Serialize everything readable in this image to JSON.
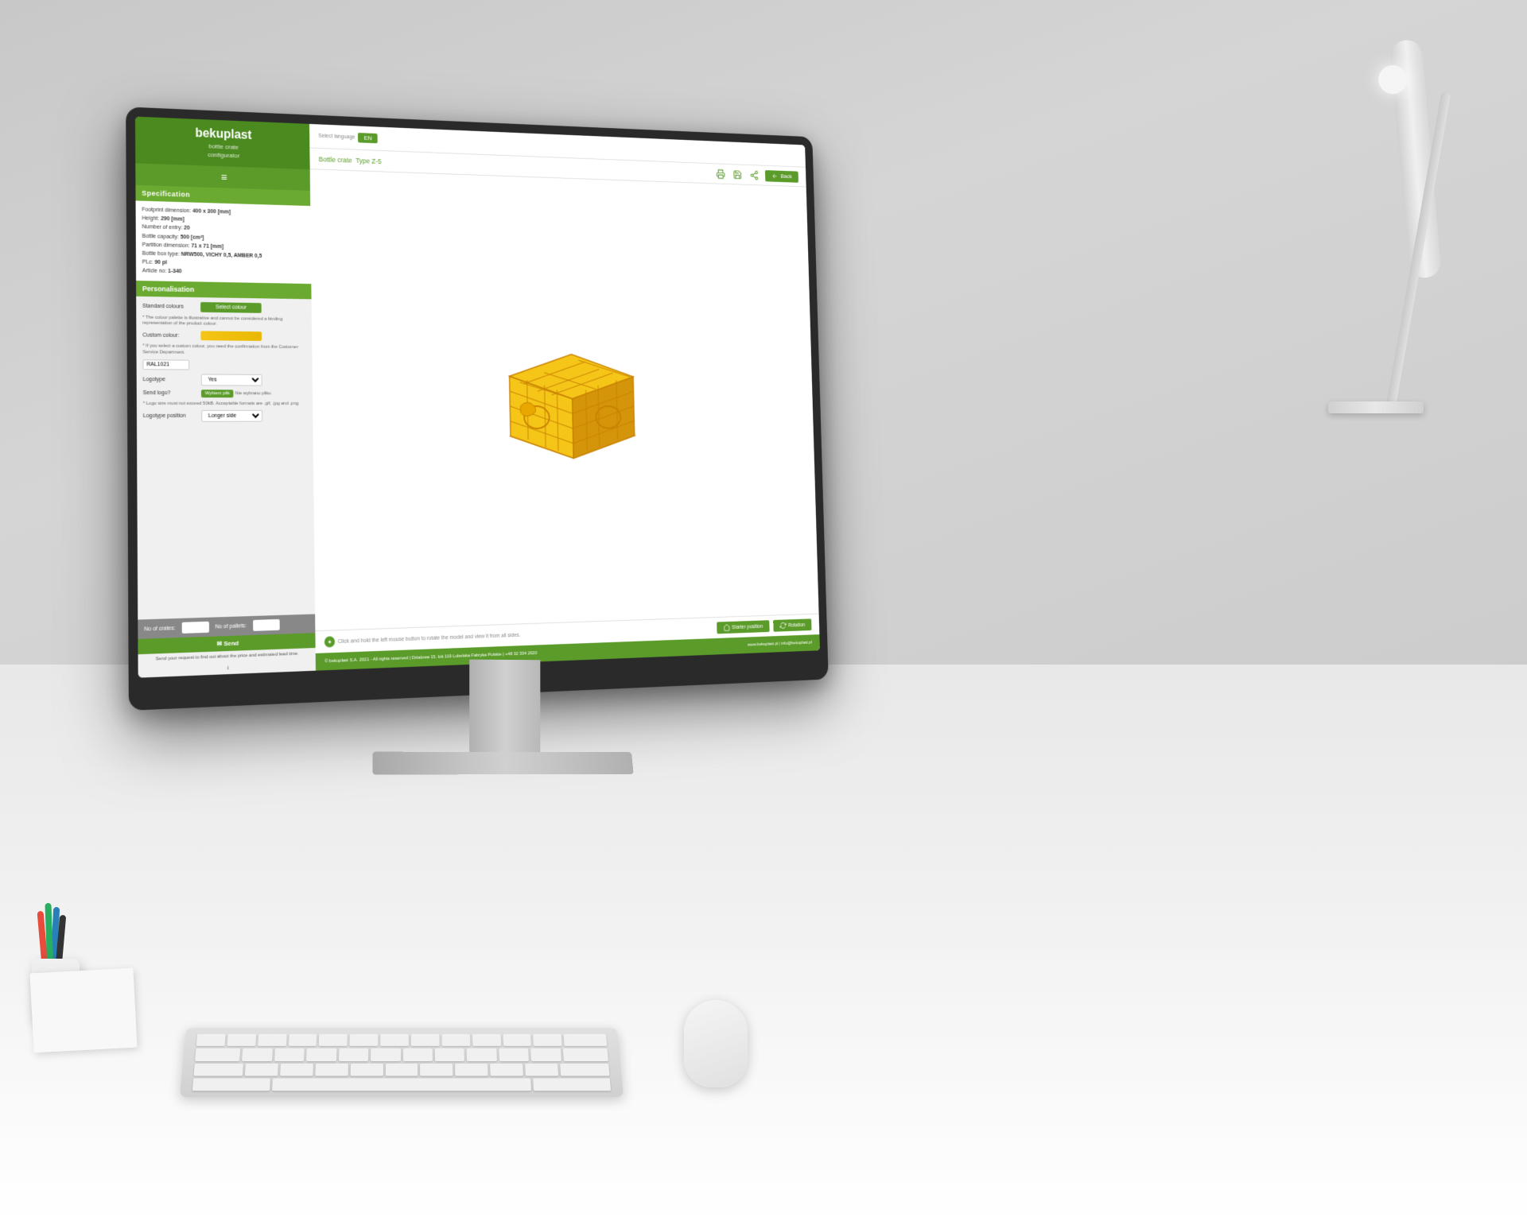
{
  "scene": {
    "wall_color": "#d0d0d0",
    "desk_color": "#f0f0f0"
  },
  "app": {
    "logo": {
      "brand": "bekuplast",
      "line1": "bottle crate",
      "line2": "configurator"
    },
    "sidebar": {
      "specification_label": "Specification",
      "spec_items": [
        "Footprint dimension: 400 x 300 [mm]",
        "Height: 290 [mm]",
        "Number of entry: 20",
        "Bottle capacity: 500 [cm³]",
        "Partition dimension: 71 x 71 [mm]",
        "Bottle box type: NRW500, VICHY 0,5, AMBER 0,5",
        "PLc: 90 pl",
        "Article no: 1-340"
      ],
      "personalisation_label": "Personalisation",
      "standard_colour_label": "Standard colours",
      "select_colour_btn": "Select colour",
      "colour_note": "* The colour palette is illustrative and cannot be considered a binding representation of the product colour.",
      "custom_colour_label": "Custom colour:",
      "custom_colour_note": "* If you select a custom colour, you need the confirmation from the Customer Service Department.",
      "ral_value": "RAL1021",
      "logotype_label": "Logotype",
      "logotype_value": "Yes",
      "send_logo_label": "Send logo?",
      "send_logo_btn": "Wybierz plik",
      "send_logo_none": "Nie wybrano pliku",
      "logo_note": "* Logo size must not exceed 50kB. Acceptable formats are .gif, .jpg and .png",
      "logotype_position_label": "Logotype position",
      "logotype_position_value": "Longer side",
      "no_crates_label": "No of crates:",
      "no_pallets_label": "No of pallets:",
      "send_btn": "✉ Send",
      "send_note": "Send your request to find out about the price and estimated lead time.",
      "footer_icon": "ℹ"
    },
    "header": {
      "select_language_label": "Select language",
      "language_value": "EN",
      "breadcrumb_part1": "Bottle crate",
      "breadcrumb_part2": "Type Z-5",
      "back_btn": "Back"
    },
    "toolbar": {
      "print_icon": "🖨",
      "save_icon": "💾",
      "share_icon": "📤"
    },
    "viewport": {
      "hint": "Click and hold the left mouse button to rotate the model and view it from all sides.",
      "starter_position_btn": "Starter position",
      "rotation_btn": "Rotation"
    },
    "footer": {
      "copyright": "© bekuplast S.A. 2021 - All rights reserved | Dzialowa 15, lok 119 Lubelska Fabryka Polskie | +48 32 334 2020",
      "website": "www.bekuplast.pl | info@bekuplast.pl"
    }
  }
}
